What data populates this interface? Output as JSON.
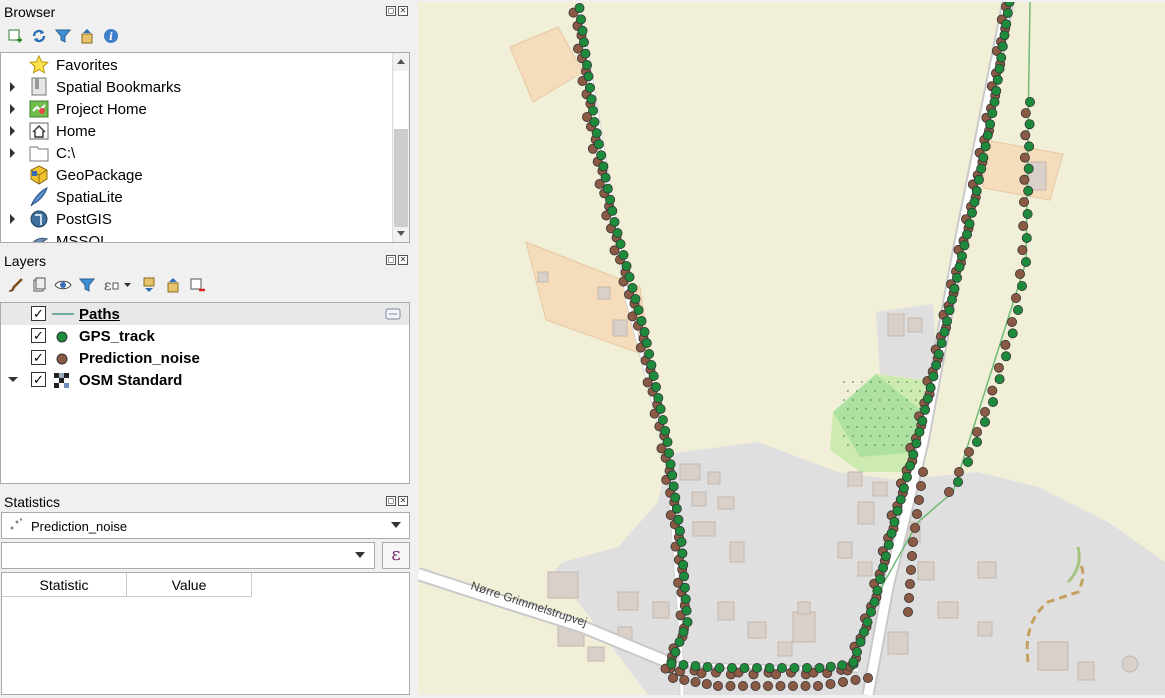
{
  "browser": {
    "title": "Browser",
    "items": [
      {
        "label": "Favorites",
        "expandable": false
      },
      {
        "label": "Spatial Bookmarks",
        "expandable": true
      },
      {
        "label": "Project Home",
        "expandable": true
      },
      {
        "label": "Home",
        "expandable": true
      },
      {
        "label": "C:\\",
        "expandable": true
      },
      {
        "label": "GeoPackage",
        "expandable": false
      },
      {
        "label": "SpatiaLite",
        "expandable": false
      },
      {
        "label": "PostGIS",
        "expandable": true
      },
      {
        "label": "MSSQL",
        "expandable": false
      }
    ]
  },
  "layers": {
    "title": "Layers",
    "items": [
      {
        "label": "Paths",
        "checked": true
      },
      {
        "label": "GPS_track",
        "checked": true
      },
      {
        "label": "Prediction_noise",
        "checked": true
      },
      {
        "label": "OSM Standard",
        "checked": true
      }
    ]
  },
  "statistics": {
    "title": "Statistics",
    "layer_select": "Prediction_noise",
    "field_value": "",
    "columns": [
      "Statistic",
      "Value"
    ],
    "expression_symbol": "ε"
  },
  "map": {
    "street_label": "Nørre Grimmelstrupvej",
    "colors": {
      "background": "#f2efd9",
      "gps": "#1e8a3c",
      "noise": "#8b5a44",
      "path": "#6fba74",
      "road": "#ffffff",
      "residential": "#e0dfdf",
      "farmyard": "#f5dcba"
    }
  }
}
